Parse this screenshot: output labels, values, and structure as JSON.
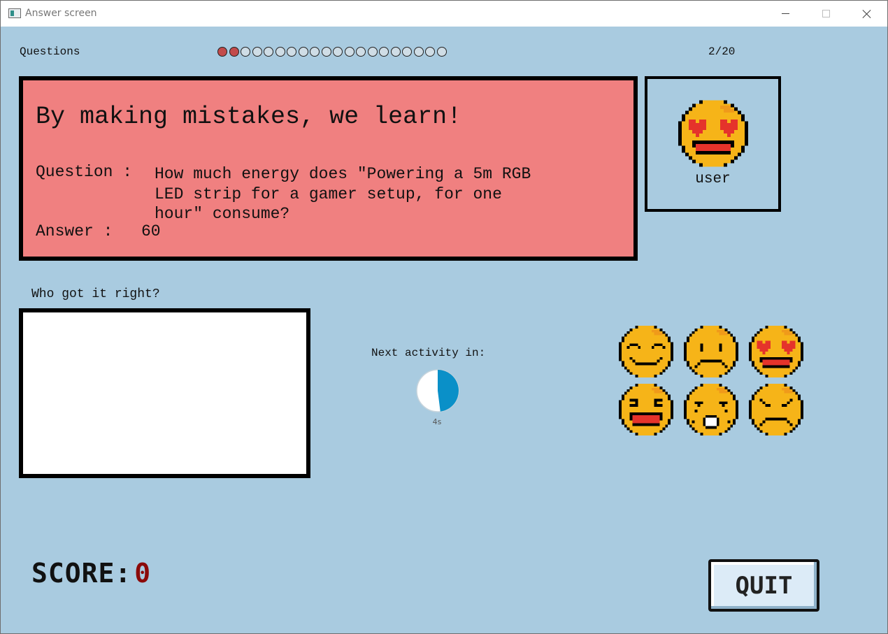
{
  "window": {
    "title": "Answer screen"
  },
  "header": {
    "questions_label": "Questions",
    "progress": {
      "current": 2,
      "total": 20
    },
    "counter": "2/20"
  },
  "feedback": {
    "title": "By making mistakes, we learn!",
    "question_label": "Question :",
    "question_text": "How much energy does \"Powering a 5m RGB LED strip for a gamer setup, for one hour\" consume?",
    "answer_label": "Answer :",
    "answer_value": "60"
  },
  "user": {
    "name": "user",
    "avatar_icon": "heart-eyes-emoji-icon"
  },
  "who_got_it_right": {
    "label": "Who got it right?",
    "entries": []
  },
  "next_activity": {
    "label": "Next activity in:",
    "seconds_label": "4s",
    "fraction_elapsed": 0.48
  },
  "reactions": [
    "smiling-emoji-icon",
    "frowning-emoji-icon",
    "heart-eyes-emoji-icon",
    "laughing-emoji-icon",
    "shocked-emoji-icon",
    "angry-emoji-icon"
  ],
  "score": {
    "label": "SCORE:",
    "value": "0"
  },
  "quit_label": "QUIT",
  "colors": {
    "background": "#a9cbe0",
    "feedback_panel": "#f08080",
    "progress_done": "#c24b4b",
    "timer": "#0a90c8",
    "score_value": "#8b0a0a",
    "emoji_face": "#f6b418",
    "emoji_heart": "#e5332b"
  }
}
